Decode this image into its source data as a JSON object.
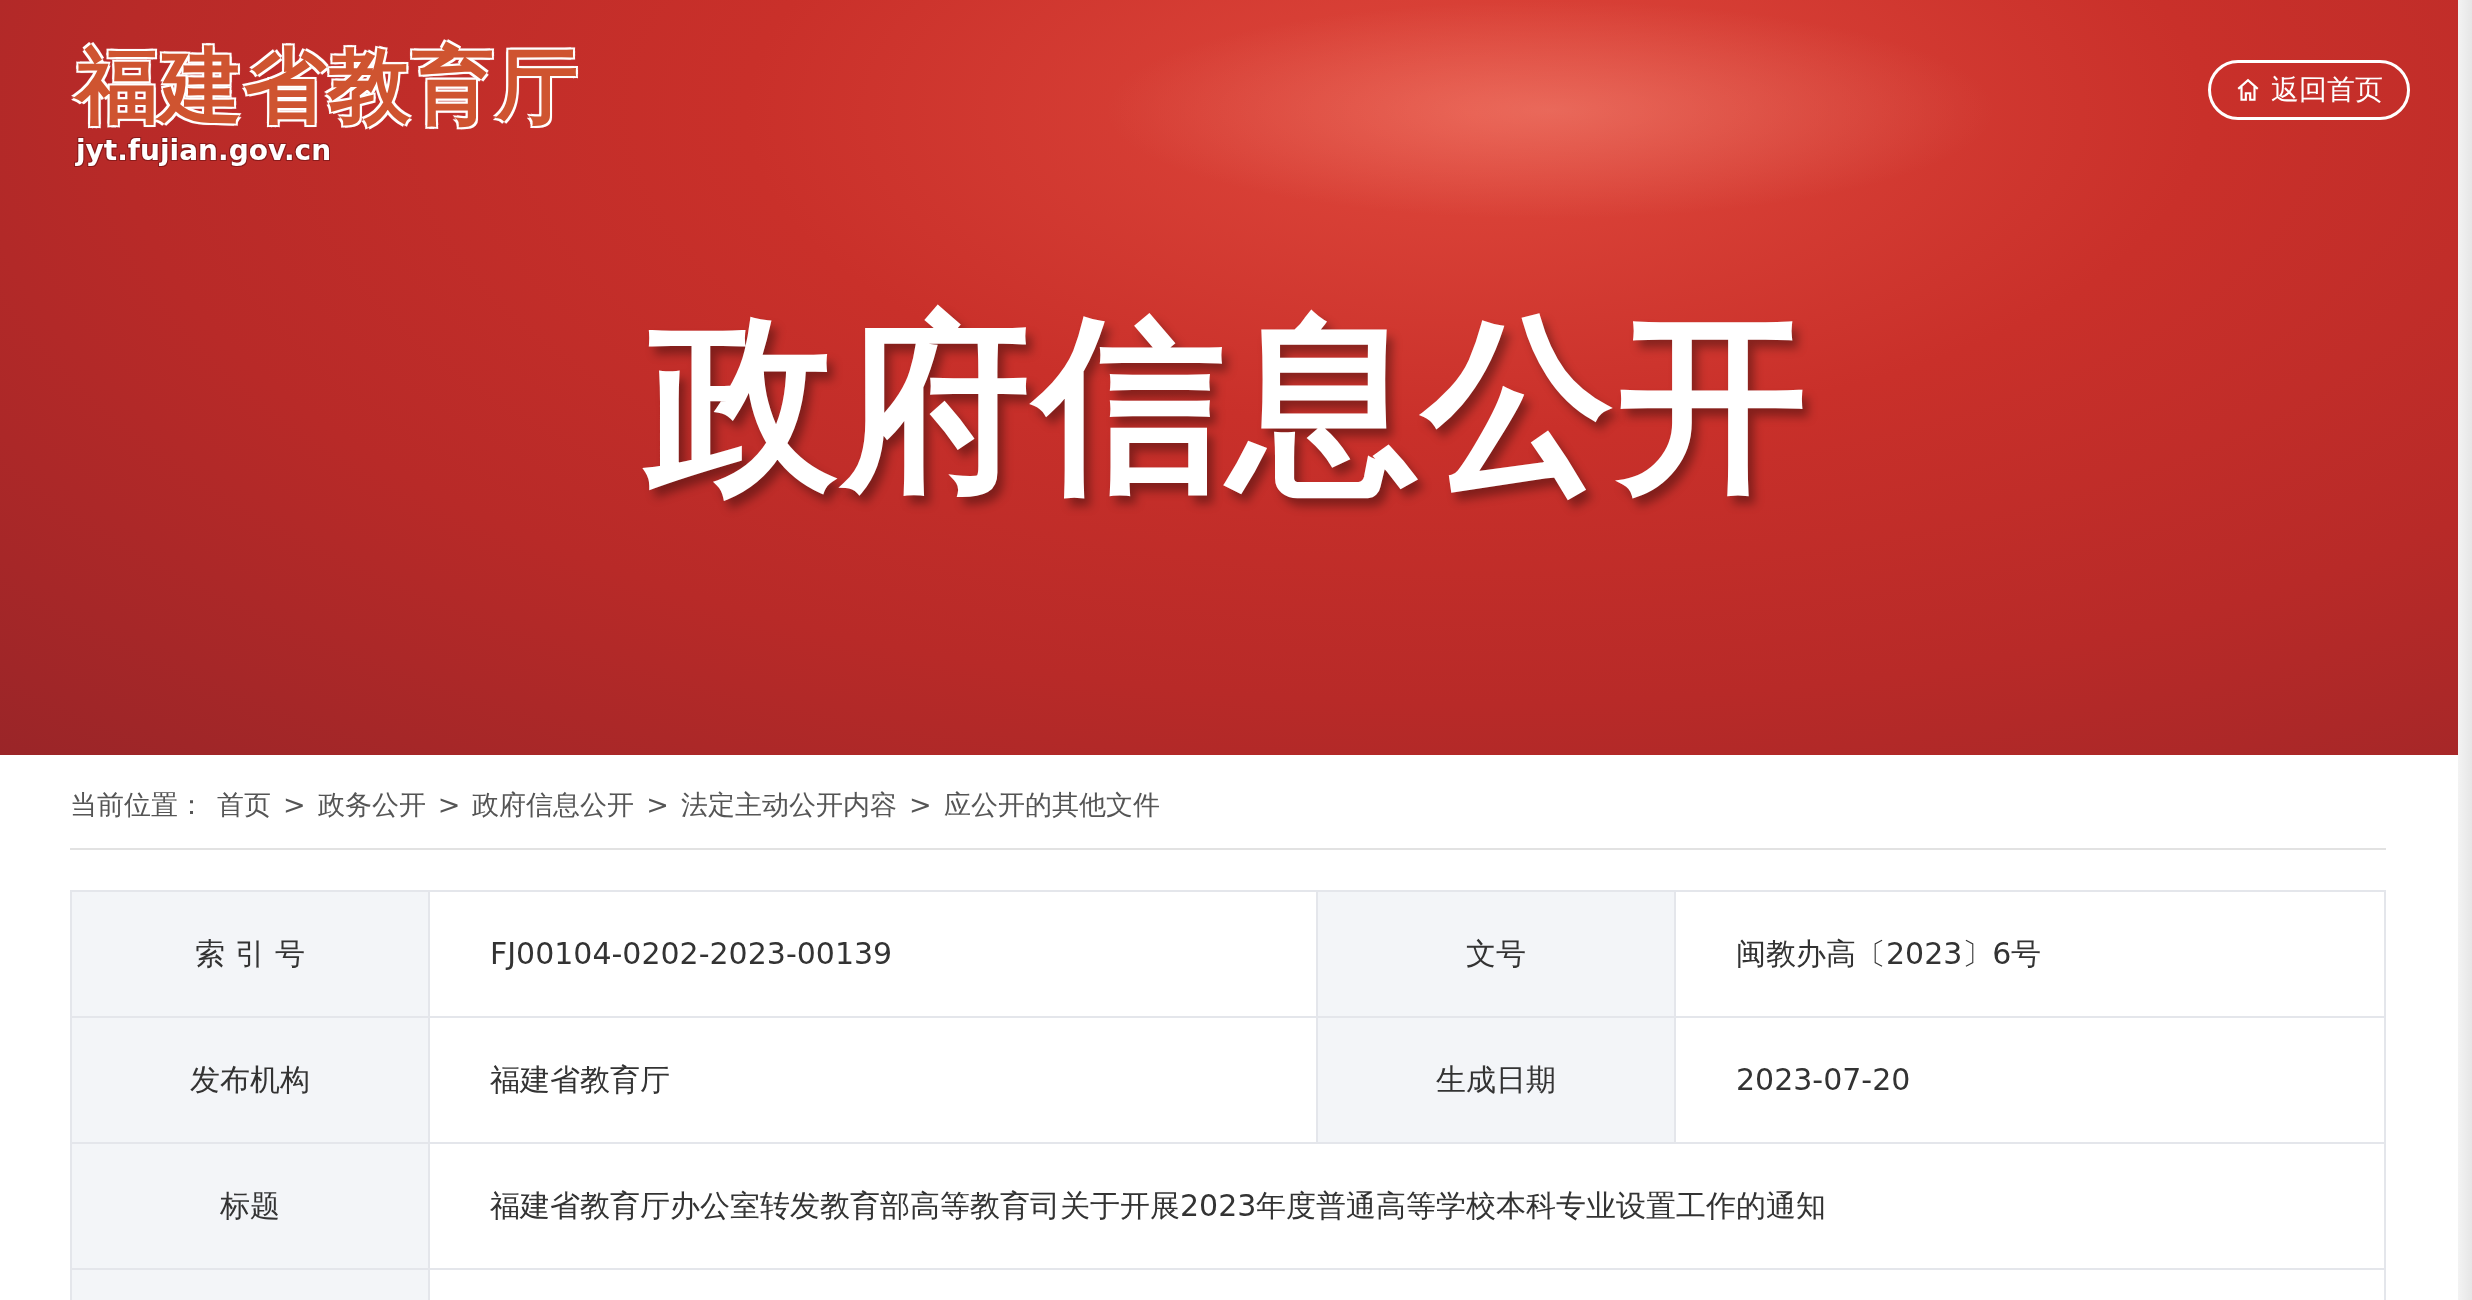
{
  "header": {
    "logo_title": "福建省教育厅",
    "logo_domain": "jyt.fujian.gov.cn",
    "home_button": "返回首页",
    "banner_title": "政府信息公开"
  },
  "breadcrumb": {
    "label": "当前位置：",
    "items": [
      "首页",
      "政务公开",
      "政府信息公开",
      "法定主动公开内容",
      "应公开的其他文件"
    ],
    "separator": ">"
  },
  "info_table": {
    "rows": [
      {
        "cells": [
          {
            "label": "索 引 号",
            "value": "FJ00104-0202-2023-00139"
          },
          {
            "label": "文号",
            "value": "闽教办高〔2023〕6号"
          }
        ]
      },
      {
        "cells": [
          {
            "label": "发布机构",
            "value": "福建省教育厅"
          },
          {
            "label": "生成日期",
            "value": "2023-07-20"
          }
        ]
      },
      {
        "cells": [
          {
            "label": "标题",
            "value": "福建省教育厅办公室转发教育部高等教育司关于开展2023年度普通高等学校本科专业设置工作的通知"
          }
        ]
      },
      {
        "cells": []
      }
    ]
  }
}
